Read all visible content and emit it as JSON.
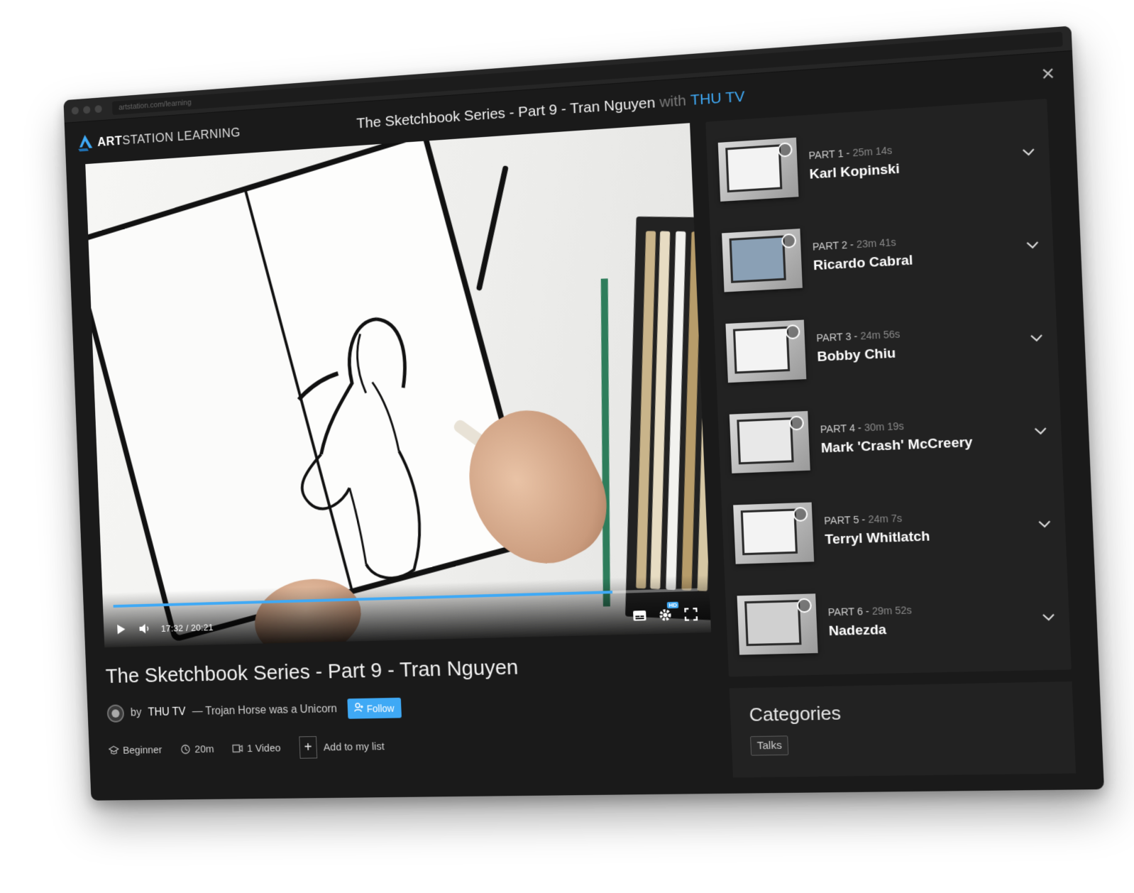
{
  "browser": {
    "url": "artstation.com/learning"
  },
  "header": {
    "logo_bold": "ART",
    "logo_rest": "STATION LEARNING",
    "title": "The Sketchbook Series - Part 9 - Tran Nguyen",
    "with_label": "with",
    "channel": "THU TV",
    "close_icon": "close-icon"
  },
  "player": {
    "current_time": "17:32",
    "separator": "/",
    "duration": "20:21",
    "progress_fraction": 0.86,
    "hd_label": "HD",
    "accent_color": "#3fa9f5"
  },
  "video_info": {
    "title": "The Sketchbook Series - Part 9 - Tran Nguyen",
    "by_label": "by",
    "channel": "THU TV",
    "subtitle": "— Trojan Horse was a Unicorn",
    "follow_label": "Follow",
    "level": "Beginner",
    "length": "20m",
    "video_count": "1 Video",
    "add_list_label": "Add to my list"
  },
  "playlist": {
    "items": [
      {
        "part": "PART 1 -",
        "duration": "25m 14s",
        "name": "Karl Kopinski"
      },
      {
        "part": "PART 2 -",
        "duration": "23m 41s",
        "name": "Ricardo Cabral"
      },
      {
        "part": "PART 3 -",
        "duration": "24m 56s",
        "name": "Bobby Chiu"
      },
      {
        "part": "PART 4 -",
        "duration": "30m 19s",
        "name": "Mark 'Crash' McCreery"
      },
      {
        "part": "PART 5 -",
        "duration": "24m 7s",
        "name": "Terryl Whitlatch"
      },
      {
        "part": "PART 6 -",
        "duration": "29m 52s",
        "name": "Nadezda"
      }
    ]
  },
  "categories": {
    "title": "Categories",
    "tags": [
      "Talks"
    ]
  }
}
